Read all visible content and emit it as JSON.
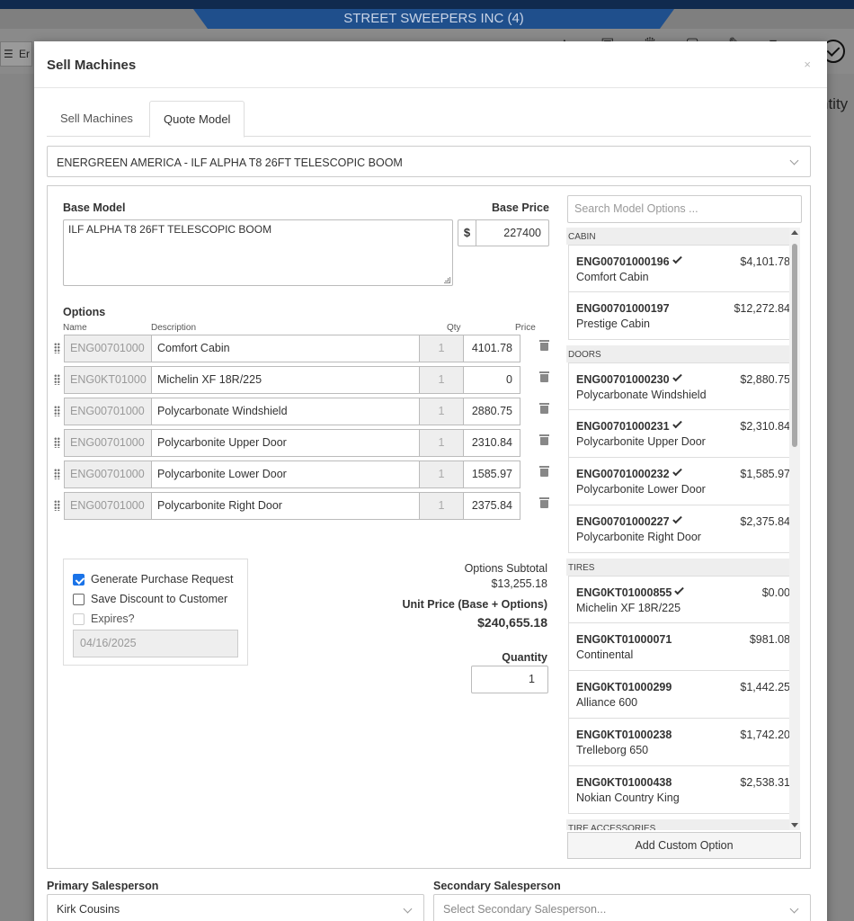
{
  "background": {
    "banner_title": "STREET SWEEPERS INC (4)",
    "left_fragment": "Er",
    "right_fragment": "ntity"
  },
  "modal": {
    "title": "Sell Machines",
    "close_glyph": "×",
    "tabs": [
      {
        "label": "Sell Machines",
        "active": false
      },
      {
        "label": "Quote Model",
        "active": true
      }
    ],
    "model_select": "ENERGREEN AMERICA - ILF ALPHA T8 26FT TELESCOPIC BOOM"
  },
  "base": {
    "model_label": "Base Model",
    "model_value": "ILF ALPHA T8 26FT TELESCOPIC BOOM",
    "price_label": "Base Price",
    "currency": "$",
    "price_value": "227400"
  },
  "options": {
    "title": "Options",
    "col_name": "Name",
    "col_desc": "Description",
    "col_qty": "Qty",
    "col_price": "Price",
    "rows": [
      {
        "code": "ENG00701000",
        "desc": "Comfort Cabin",
        "qty": "1",
        "price": "4101.78"
      },
      {
        "code": "ENG0KT01000",
        "desc": "Michelin XF 18R/225",
        "qty": "1",
        "price": "0"
      },
      {
        "code": "ENG00701000",
        "desc": "Polycarbonate Windshield",
        "qty": "1",
        "price": "2880.75"
      },
      {
        "code": "ENG00701000",
        "desc": "Polycarbonite Upper Door",
        "qty": "1",
        "price": "2310.84"
      },
      {
        "code": "ENG00701000",
        "desc": "Polycarbonite Lower Door",
        "qty": "1",
        "price": "1585.97"
      },
      {
        "code": "ENG00701000",
        "desc": "Polycarbonite Right Door",
        "qty": "1",
        "price": "2375.84"
      }
    ]
  },
  "checks": {
    "generate_pr": "Generate Purchase Request",
    "save_discount": "Save Discount to Customer",
    "expires": "Expires?",
    "expires_date": "04/16/2025"
  },
  "totals": {
    "subtotal_label": "Options Subtotal",
    "subtotal_value": "$13,255.18",
    "unit_label": "Unit Price (Base + Options)",
    "unit_value": "$240,655.18",
    "quantity_label": "Quantity",
    "quantity_value": "1"
  },
  "model_options": {
    "search_placeholder": "Search Model Options ...",
    "categories": [
      {
        "name": "CABIN",
        "items": [
          {
            "code": "ENG00701000196",
            "name": "Comfort Cabin",
            "price": "$4,101.78",
            "selected": true
          },
          {
            "code": "ENG00701000197",
            "name": "Prestige Cabin",
            "price": "$12,272.84",
            "selected": false
          }
        ]
      },
      {
        "name": "DOORS",
        "items": [
          {
            "code": "ENG00701000230",
            "name": "Polycarbonate Windshield",
            "price": "$2,880.75",
            "selected": true
          },
          {
            "code": "ENG00701000231",
            "name": "Polycarbonite Upper Door",
            "price": "$2,310.84",
            "selected": true
          },
          {
            "code": "ENG00701000232",
            "name": "Polycarbonite Lower Door",
            "price": "$1,585.97",
            "selected": true
          },
          {
            "code": "ENG00701000227",
            "name": "Polycarbonite Right Door",
            "price": "$2,375.84",
            "selected": true
          }
        ]
      },
      {
        "name": "TIRES",
        "items": [
          {
            "code": "ENG0KT01000855",
            "name": "Michelin XF 18R/225",
            "price": "$0.00",
            "selected": true
          },
          {
            "code": "ENG0KT01000071",
            "name": "Continental",
            "price": "$981.08",
            "selected": false
          },
          {
            "code": "ENG0KT01000299",
            "name": "Alliance 600",
            "price": "$1,442.25",
            "selected": false
          },
          {
            "code": "ENG0KT01000238",
            "name": "Trelleborg 650",
            "price": "$1,742.20",
            "selected": false
          },
          {
            "code": "ENG0KT01000438",
            "name": "Nokian Country King",
            "price": "$2,538.31",
            "selected": false
          }
        ]
      },
      {
        "name": "TIRE ACCESSORIES",
        "items": []
      }
    ],
    "add_custom": "Add Custom Option"
  },
  "sales": {
    "primary_label": "Primary Salesperson",
    "primary_value": "Kirk Cousins",
    "secondary_label": "Secondary Salesperson",
    "secondary_placeholder": "Select Secondary Salesperson..."
  },
  "colors": {
    "accent_blue": "#1a73e8",
    "banner_blue": "#1f4f8c"
  }
}
